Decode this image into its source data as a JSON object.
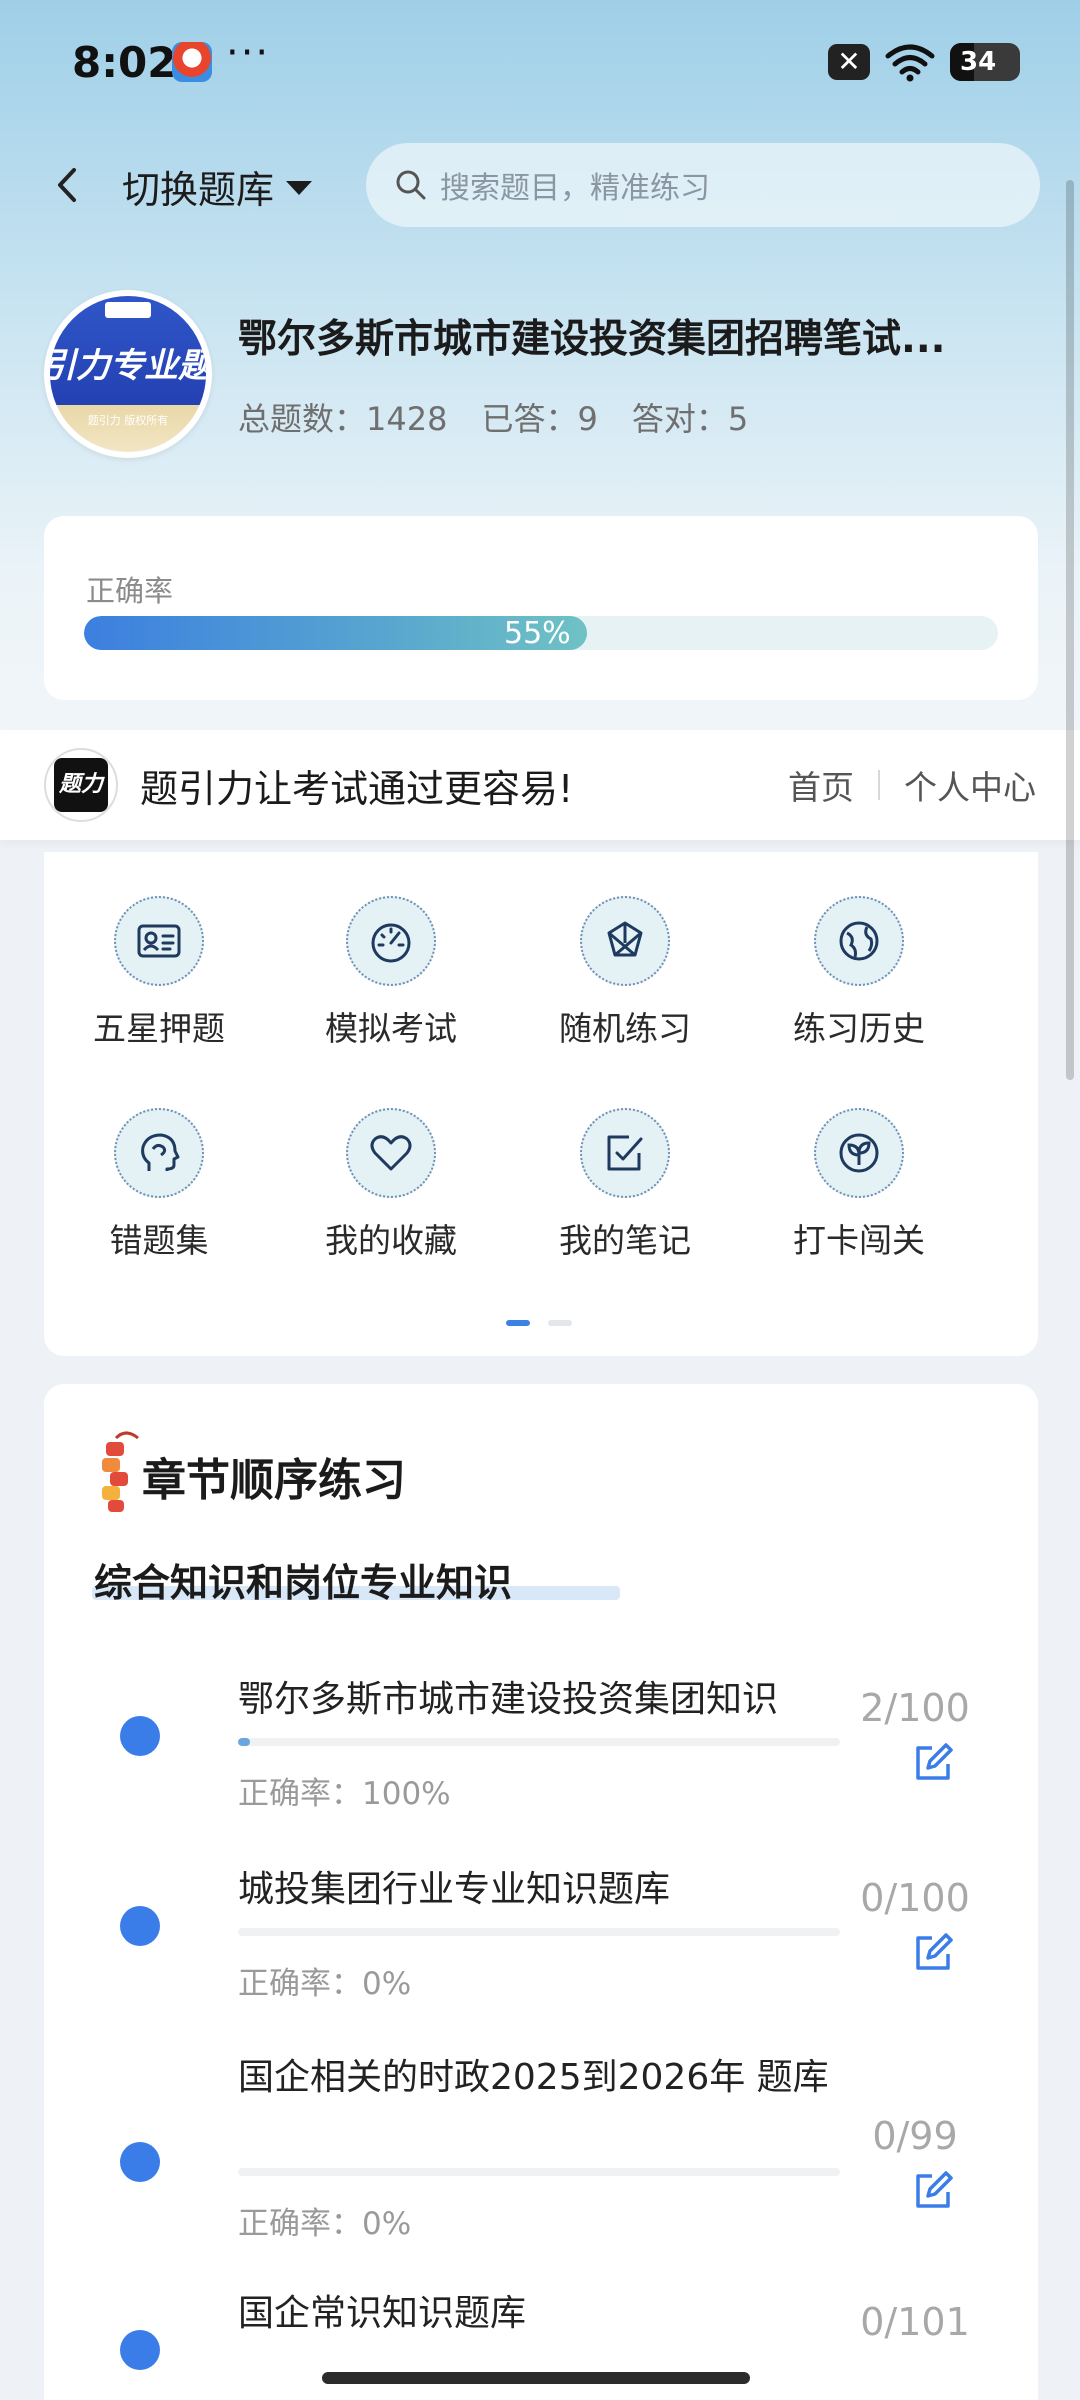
{
  "status_bar": {
    "time": "8:02",
    "dots": "···",
    "sim_label": "✕",
    "battery": "34"
  },
  "header": {
    "switch_label": "切换题库",
    "search_placeholder": "搜索题目，精准练习"
  },
  "bank": {
    "logo_text": "引力专业题",
    "logo_small": "题引力 版权所有",
    "title": "鄂尔多斯市城市建设投资集团招聘笔试...",
    "stats": [
      {
        "label": "总题数：",
        "value": "1428"
      },
      {
        "label": "已答：",
        "value": "9"
      },
      {
        "label": "答对：",
        "value": "5"
      }
    ]
  },
  "accuracy": {
    "label": "正确率",
    "percent": 55,
    "percent_text": "55%"
  },
  "banner": {
    "slogan": "题引力让考试通过更容易!",
    "links": [
      "首页",
      "个人中心"
    ]
  },
  "features": [
    {
      "label": "五星押题",
      "icon": "id-card-icon"
    },
    {
      "label": "模拟考试",
      "icon": "speedometer-icon"
    },
    {
      "label": "随机练习",
      "icon": "shuffle-icon"
    },
    {
      "label": "练习历史",
      "icon": "globe-icon"
    },
    {
      "label": "错题集",
      "icon": "brain-head-icon"
    },
    {
      "label": "我的收藏",
      "icon": "heart-icon"
    },
    {
      "label": "我的笔记",
      "icon": "note-check-icon"
    },
    {
      "label": "打卡闯关",
      "icon": "sprout-icon"
    }
  ],
  "pager": {
    "pages": 2,
    "active": 0
  },
  "chapter": {
    "title": "章节顺序练习",
    "section": "综合知识和岗位专业知识",
    "items": [
      {
        "name": "鄂尔多斯市城市建设投资集团知识",
        "count": "2/100",
        "progress": 0.02,
        "accuracy": "正确率：100%"
      },
      {
        "name": "城投集团行业专业知识题库",
        "count": "0/100",
        "progress": 0,
        "accuracy": "正确率：0%"
      },
      {
        "name": "国企相关的时政2025到2026年 题库",
        "count": "0/99",
        "progress": 0,
        "accuracy": "正确率：0%"
      },
      {
        "name": "国企常识知识题库",
        "count": "0/101",
        "progress": 0,
        "accuracy": ""
      }
    ]
  },
  "colors": {
    "accent": "#3b7de8",
    "card": "#ffffff",
    "icon_bg": "#e4f2f6"
  }
}
